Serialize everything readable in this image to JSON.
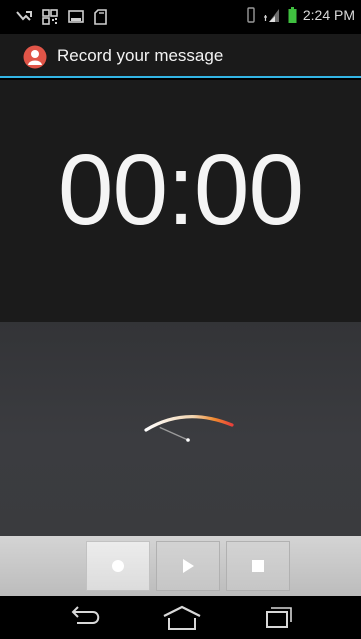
{
  "status_bar": {
    "time": "2:24 PM",
    "icons": [
      "missed-call-icon",
      "qr-code-icon",
      "image-icon",
      "sd-card-icon",
      "vibrate-icon",
      "signal-icon",
      "battery-icon"
    ]
  },
  "action_bar": {
    "title": "Record your message",
    "icon": "recorder-app-icon"
  },
  "timer": {
    "value": "00:00"
  },
  "vu_meter": {
    "level": 0
  },
  "controls": {
    "record": "record-icon",
    "play": "play-icon",
    "stop": "stop-icon"
  },
  "navigation": {
    "back": "back-icon",
    "home": "home-icon",
    "recents": "recent-apps-icon"
  },
  "colors": {
    "accent": "#33b5e5",
    "app_icon": "#e05548",
    "meter_start": "#ffffff",
    "meter_end": "#e8403a"
  }
}
